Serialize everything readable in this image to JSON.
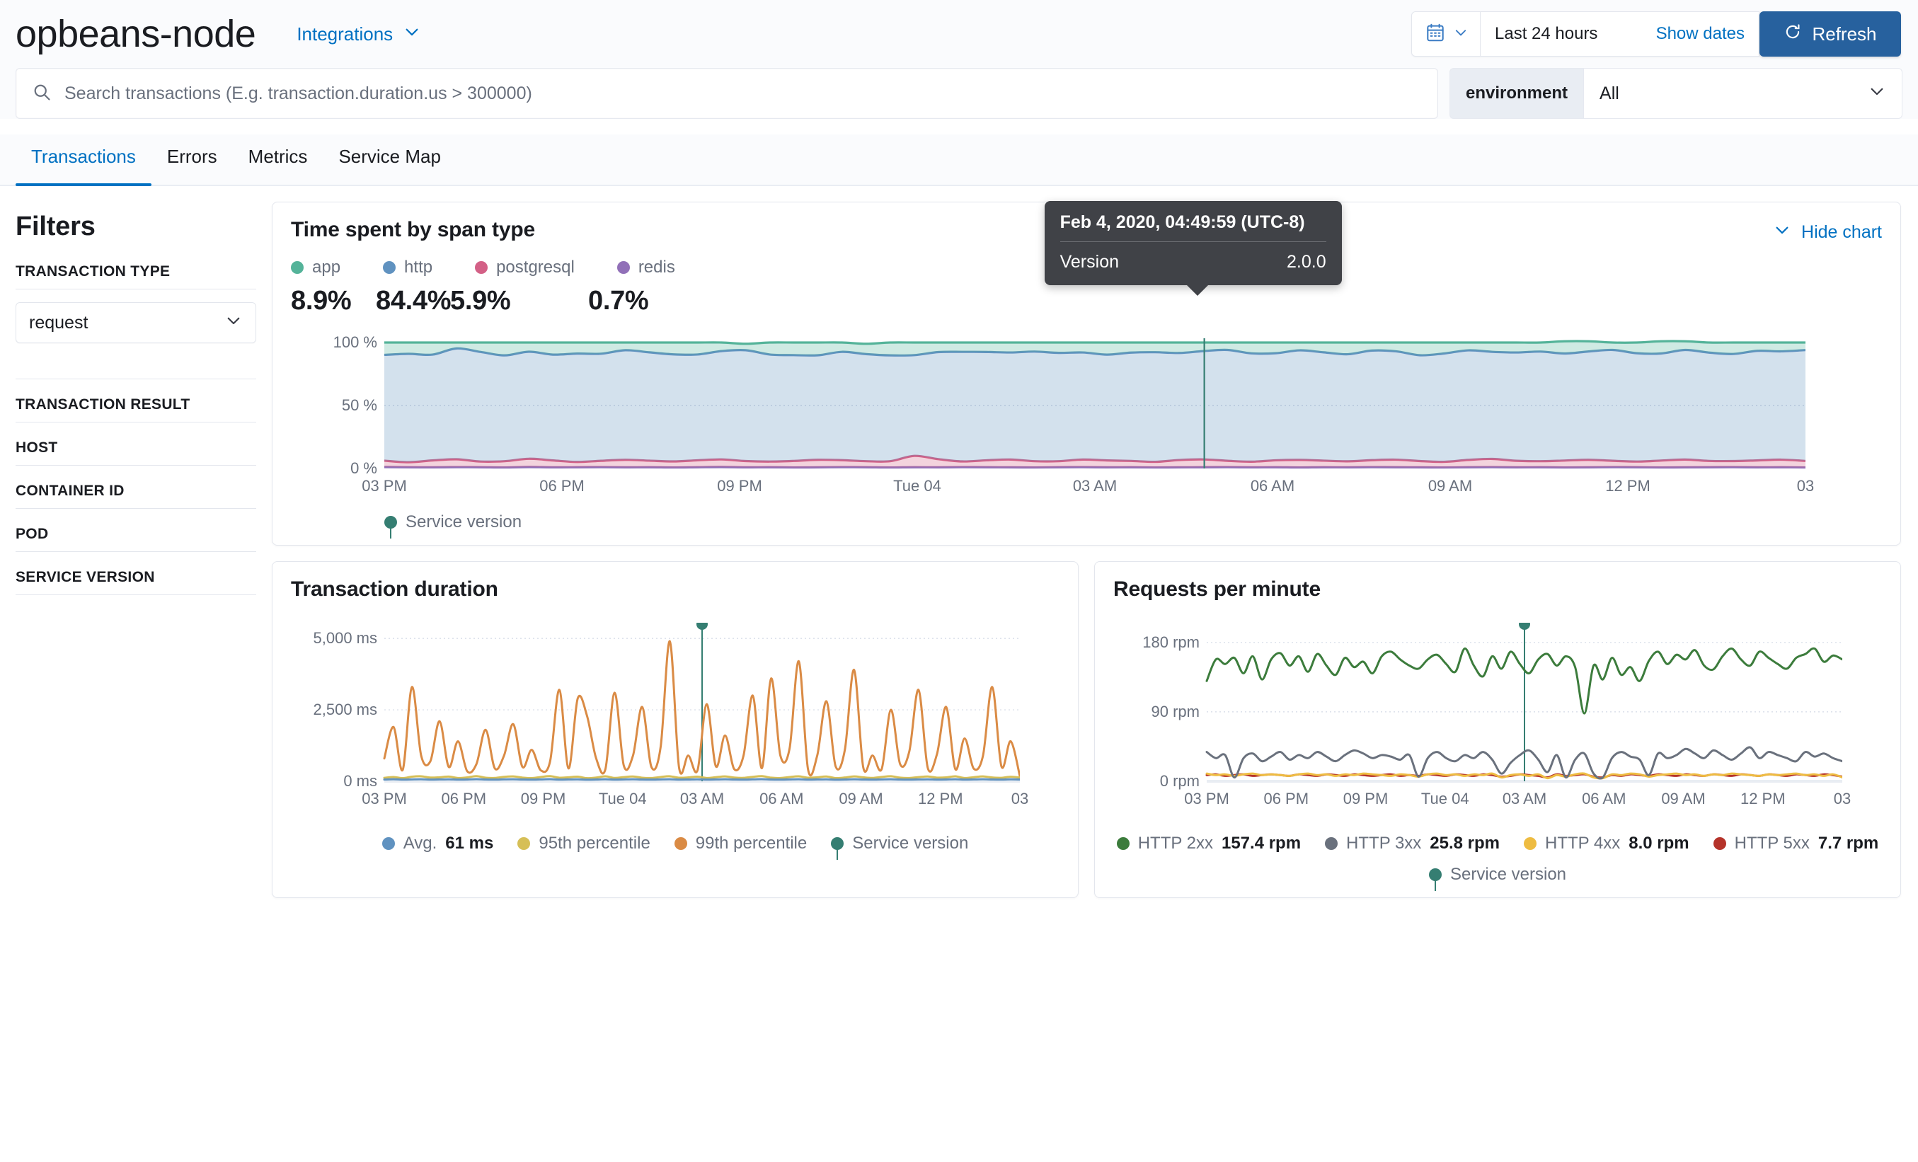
{
  "header": {
    "service_title": "opbeans-node",
    "integrations_label": "Integrations",
    "integrations_icon": "chevron-down-icon",
    "calendar_icon": "calendar-icon",
    "date_range": "Last 24 hours",
    "show_dates_label": "Show dates",
    "refresh_label": "Refresh",
    "refresh_icon": "refresh-icon"
  },
  "search": {
    "icon": "search-icon",
    "placeholder": "Search transactions (E.g. transaction.duration.us > 300000)",
    "value": "",
    "environment_label": "environment",
    "environment_value": "All",
    "environment_icon": "chevron-down-icon"
  },
  "tabs": [
    {
      "label": "Transactions",
      "active": true
    },
    {
      "label": "Errors",
      "active": false
    },
    {
      "label": "Metrics",
      "active": false
    },
    {
      "label": "Service Map",
      "active": false
    }
  ],
  "sidebar": {
    "title": "Filters",
    "transaction_type_label": "TRANSACTION TYPE",
    "transaction_type_value": "request",
    "transaction_type_icon": "chevron-down-icon",
    "items": [
      {
        "label": "TRANSACTION RESULT"
      },
      {
        "label": "HOST"
      },
      {
        "label": "CONTAINER ID"
      },
      {
        "label": "POD"
      },
      {
        "label": "SERVICE VERSION"
      }
    ]
  },
  "span_chart": {
    "title": "Time spent by span type",
    "hide_chart_label": "Hide chart",
    "hide_chart_icon": "chevron-down-icon",
    "service_version_legend": "Service version",
    "tooltip": {
      "title": "Feb 4, 2020, 04:49:59 (UTC-8)",
      "row_label": "Version",
      "row_value": "2.0.0"
    }
  },
  "duration_chart": {
    "title": "Transaction duration"
  },
  "rpm_chart": {
    "title": "Requests per minute"
  },
  "chart_data": [
    {
      "id": "time-spent-by-span-type",
      "type": "area",
      "title": "Time spent by span type",
      "stacked": true,
      "percent": true,
      "xlabel": "",
      "ylabel": "",
      "ylim": [
        0,
        100
      ],
      "ytick_labels": [
        "0 %",
        "50 %",
        "100 %"
      ],
      "ytick_values": [
        0,
        50,
        100
      ],
      "xtick_labels": [
        "03 PM",
        "06 PM",
        "09 PM",
        "Tue 04",
        "03 AM",
        "06 AM",
        "09 AM",
        "12 PM",
        "03"
      ],
      "grid": true,
      "legend_position": "top",
      "legend": [
        {
          "name": "app",
          "color": "#54B399",
          "value": "8.9%"
        },
        {
          "name": "http",
          "color": "#6092C0",
          "value": "84.4%"
        },
        {
          "name": "postgresql",
          "color": "#D36086",
          "value": "5.9%"
        },
        {
          "name": "redis",
          "color": "#9170B8",
          "value": "0.7%"
        }
      ],
      "annotation": {
        "name": "Service version",
        "color": "#357E72",
        "x_fraction": 0.577,
        "tooltip_title": "Feb 4, 2020, 04:49:59 (UTC-8)",
        "tooltip_label": "Version",
        "tooltip_value": "2.0.0"
      },
      "series": [
        {
          "name": "redis",
          "color": "#9170B8",
          "values": [
            1.2,
            1.0,
            0.9,
            1.1,
            1.0,
            0.8,
            1.2,
            0.9,
            1.0,
            1.1,
            0.9,
            1.0,
            0.8,
            1.0,
            1.2,
            0.9,
            1.0,
            0.8,
            0.9,
            1.1,
            1.0,
            0.8,
            1.0,
            0.9,
            1.1,
            1.0,
            0.9,
            0.8,
            1.0,
            1.1,
            0.9,
            1.0,
            0.8,
            0.9,
            1.0,
            1.1,
            0.9,
            1.0,
            0.8,
            1.0,
            0.9,
            1.1,
            1.0,
            0.9,
            0.8,
            1.0,
            1.1,
            0.9,
            1.0,
            0.8,
            0.9,
            1.1,
            1.0,
            0.8,
            0.9,
            1.0,
            1.1,
            0.9,
            1.0,
            0.8
          ]
        },
        {
          "name": "postgresql",
          "color": "#D36086",
          "values": [
            5.0,
            4.0,
            5.5,
            6.2,
            4.5,
            5.0,
            6.5,
            5.5,
            4.2,
            5.0,
            6.0,
            5.2,
            4.8,
            5.5,
            6.0,
            5.0,
            4.5,
            5.2,
            6.0,
            5.5,
            4.8,
            5.0,
            9.0,
            6.5,
            4.5,
            5.5,
            6.2,
            5.0,
            4.8,
            6.0,
            5.5,
            5.0,
            4.5,
            5.8,
            6.2,
            5.0,
            4.5,
            5.5,
            6.0,
            5.2,
            4.8,
            5.5,
            6.0,
            5.0,
            4.5,
            5.8,
            6.5,
            5.2,
            4.8,
            5.5,
            6.0,
            5.0,
            4.5,
            5.5,
            6.2,
            5.0,
            4.8,
            5.5,
            6.0,
            5.2
          ]
        },
        {
          "name": "http",
          "color": "#6092C0",
          "values": [
            84,
            86,
            84,
            88,
            87,
            84,
            85,
            84,
            86,
            85,
            87,
            86,
            85,
            84,
            86,
            88,
            85,
            84,
            83,
            86,
            85,
            84,
            80,
            85,
            87,
            86,
            85,
            87,
            86,
            85,
            84,
            86,
            87,
            85,
            86,
            88,
            86,
            85,
            87,
            86,
            85,
            87,
            86,
            84,
            86,
            87,
            85,
            86,
            87,
            85,
            86,
            88,
            86,
            85,
            87,
            86,
            85,
            87,
            86,
            88
          ]
        },
        {
          "name": "app",
          "color": "#54B399",
          "values": [
            9.8,
            9.0,
            9.6,
            4.7,
            7.5,
            10.2,
            7.3,
            9.6,
            8.8,
            8.9,
            6.1,
            7.8,
            9.4,
            9.5,
            6.8,
            5.1,
            9.5,
            10.0,
            10.1,
            7.4,
            8.2,
            10.2,
            10.0,
            7.6,
            7.4,
            7.5,
            7.9,
            7.2,
            8.2,
            7.9,
            9.6,
            8.0,
            7.7,
            8.3,
            6.8,
            5.9,
            8.6,
            8.5,
            6.2,
            7.8,
            9.3,
            6.4,
            7.0,
            10.1,
            8.7,
            6.2,
            7.4,
            7.9,
            7.2,
            9.7,
            8.1,
            5.9,
            8.5,
            9.7,
            6.9,
            8.0,
            9.1,
            6.6,
            7.0,
            6.0
          ]
        }
      ]
    },
    {
      "id": "transaction-duration",
      "type": "line",
      "title": "Transaction duration",
      "xlabel": "",
      "ylabel": "",
      "ylim": [
        0,
        5400
      ],
      "ytick_labels": [
        "0 ms",
        "2,500 ms",
        "5,000 ms"
      ],
      "ytick_values": [
        0,
        2500,
        5000
      ],
      "xtick_labels": [
        "03 PM",
        "06 PM",
        "09 PM",
        "Tue 04",
        "03 AM",
        "06 AM",
        "09 AM",
        "12 PM",
        "03"
      ],
      "grid": true,
      "legend_position": "bottom",
      "legend": [
        {
          "name": "Avg.",
          "color": "#6092C0",
          "value": "61 ms"
        },
        {
          "name": "95th percentile",
          "color": "#D6BF57",
          "value": ""
        },
        {
          "name": "99th percentile",
          "color": "#DA8B45",
          "value": ""
        },
        {
          "name": "Service version",
          "color": "#357E72",
          "value": ""
        }
      ],
      "annotation": {
        "name": "Service version",
        "color": "#357E72",
        "x_fraction": 0.5
      },
      "series": [
        {
          "name": "Avg.",
          "color": "#6092C0",
          "values": [
            61,
            70,
            58,
            66,
            72,
            60,
            64,
            69,
            58,
            63,
            75,
            61,
            59,
            67,
            70,
            62,
            58,
            66,
            73,
            60,
            64,
            68,
            57,
            62,
            71,
            59,
            65,
            70,
            61,
            58,
            66,
            72,
            60,
            63,
            69,
            58,
            64,
            70,
            62,
            59,
            67,
            73,
            61,
            58,
            65,
            71,
            60,
            64,
            69,
            57,
            62,
            70,
            63,
            59,
            66,
            72,
            61,
            58,
            64,
            69,
            60,
            63,
            71,
            58,
            64,
            70,
            62,
            59,
            67,
            61
          ]
        },
        {
          "name": "95th percentile",
          "color": "#D6BF57",
          "values": [
            120,
            150,
            110,
            160,
            175,
            130,
            140,
            165,
            115,
            135,
            180,
            125,
            118,
            155,
            170,
            128,
            112,
            150,
            178,
            125,
            140,
            160,
            110,
            130,
            172,
            118,
            145,
            168,
            125,
            115,
            150,
            175,
            124,
            135,
            162,
            116,
            142,
            170,
            130,
            120,
            155,
            178,
            126,
            114,
            148,
            172,
            124,
            140,
            166,
            112,
            132,
            170,
            138,
            118,
            152,
            176,
            126,
            115,
            145,
            168,
            128,
            136,
            174,
            116,
            144,
            170,
            132,
            122,
            158,
            130
          ]
        },
        {
          "name": "99th percentile",
          "color": "#DA8B45",
          "values": [
            800,
            1900,
            400,
            3300,
            900,
            700,
            2100,
            500,
            1400,
            350,
            600,
            1800,
            450,
            900,
            2000,
            500,
            1100,
            380,
            700,
            3200,
            450,
            2900,
            2300,
            800,
            420,
            3100,
            550,
            900,
            2600,
            500,
            1200,
            4900,
            480,
            900,
            380,
            2700,
            520,
            1600,
            420,
            900,
            3000,
            460,
            3600,
            900,
            1150,
            4200,
            420,
            900,
            2800,
            520,
            1100,
            3900,
            480,
            900,
            430,
            2500,
            600,
            1050,
            3200,
            470,
            950,
            2600,
            420,
            1500,
            440,
            900,
            3300,
            520,
            1400,
            180
          ]
        }
      ]
    },
    {
      "id": "requests-per-minute",
      "type": "line",
      "title": "Requests per minute",
      "xlabel": "",
      "ylabel": "",
      "ylim": [
        0,
        200
      ],
      "ytick_labels": [
        "0 rpm",
        "90 rpm",
        "180 rpm"
      ],
      "ytick_values": [
        0,
        90,
        180
      ],
      "xtick_labels": [
        "03 PM",
        "06 PM",
        "09 PM",
        "Tue 04",
        "03 AM",
        "06 AM",
        "09 AM",
        "12 PM",
        "03"
      ],
      "grid": true,
      "legend_position": "bottom",
      "legend": [
        {
          "name": "HTTP 2xx",
          "color": "#3C7C3C",
          "value": "157.4 rpm"
        },
        {
          "name": "HTTP 3xx",
          "color": "#6A717D",
          "value": "25.8 rpm"
        },
        {
          "name": "HTTP 4xx",
          "color": "#EEBC42",
          "value": "8.0 rpm"
        },
        {
          "name": "HTTP 5xx",
          "color": "#B5332A",
          "value": "7.7 rpm"
        },
        {
          "name": "Service version",
          "color": "#357E72",
          "value": ""
        }
      ],
      "annotation": {
        "name": "Service version",
        "color": "#357E72",
        "x_fraction": 0.5
      },
      "series": [
        {
          "name": "HTTP 2xx",
          "color": "#3C7C3C",
          "values": [
            130,
            158,
            152,
            160,
            140,
            162,
            132,
            158,
            166,
            150,
            162,
            142,
            165,
            150,
            138,
            160,
            148,
            155,
            140,
            162,
            168,
            158,
            150,
            146,
            158,
            164,
            152,
            142,
            172,
            150,
            136,
            162,
            146,
            168,
            152,
            140,
            158,
            165,
            150,
            162,
            148,
            88,
            150,
            132,
            160,
            138,
            148,
            130,
            156,
            168,
            152,
            164,
            158,
            170,
            150,
            145,
            162,
            172,
            158,
            150,
            168,
            160,
            152,
            146,
            160,
            165,
            172,
            155,
            163,
            158
          ]
        },
        {
          "name": "HTTP 3xx",
          "color": "#6A717D",
          "values": [
            38,
            30,
            34,
            5,
            30,
            36,
            26,
            32,
            38,
            28,
            34,
            30,
            38,
            32,
            26,
            34,
            40,
            36,
            30,
            34,
            32,
            28,
            34,
            6,
            30,
            38,
            30,
            26,
            34,
            30,
            38,
            28,
            10,
            24,
            34,
            40,
            28,
            12,
            34,
            5,
            28,
            36,
            10,
            5,
            30,
            38,
            32,
            28,
            8,
            36,
            30,
            34,
            42,
            36,
            30,
            40,
            34,
            28,
            36,
            44,
            30,
            38,
            34,
            30,
            26,
            38,
            32,
            36,
            30,
            26
          ]
        },
        {
          "name": "HTTP 4xx",
          "color": "#EEBC42",
          "values": [
            10,
            8,
            9,
            7,
            9,
            10,
            8,
            9,
            8,
            7,
            9,
            10,
            8,
            9,
            7,
            9,
            8,
            10,
            9,
            8,
            7,
            9,
            8,
            6,
            9,
            10,
            8,
            9,
            7,
            9,
            8,
            10,
            5,
            8,
            9,
            7,
            9,
            4,
            8,
            6,
            9,
            10,
            5,
            4,
            9,
            8,
            10,
            9,
            6,
            8,
            9,
            10,
            8,
            9,
            7,
            9,
            8,
            10,
            9,
            8,
            7,
            9,
            8,
            9,
            10,
            8,
            9,
            7,
            9,
            5
          ]
        },
        {
          "name": "HTTP 5xx",
          "color": "#B5332A",
          "values": [
            8,
            9,
            7,
            8,
            9,
            7,
            8,
            9,
            8,
            7,
            9,
            8,
            7,
            9,
            8,
            7,
            9,
            8,
            7,
            8,
            9,
            7,
            8,
            7,
            9,
            8,
            7,
            9,
            8,
            7,
            9,
            8,
            6,
            7,
            9,
            8,
            7,
            5,
            9,
            7,
            8,
            9,
            6,
            5,
            8,
            7,
            9,
            8,
            7,
            9,
            8,
            7,
            9,
            8,
            7,
            9,
            8,
            7,
            9,
            8,
            7,
            9,
            8,
            7,
            9,
            8,
            7,
            9,
            8,
            6
          ]
        }
      ]
    }
  ]
}
